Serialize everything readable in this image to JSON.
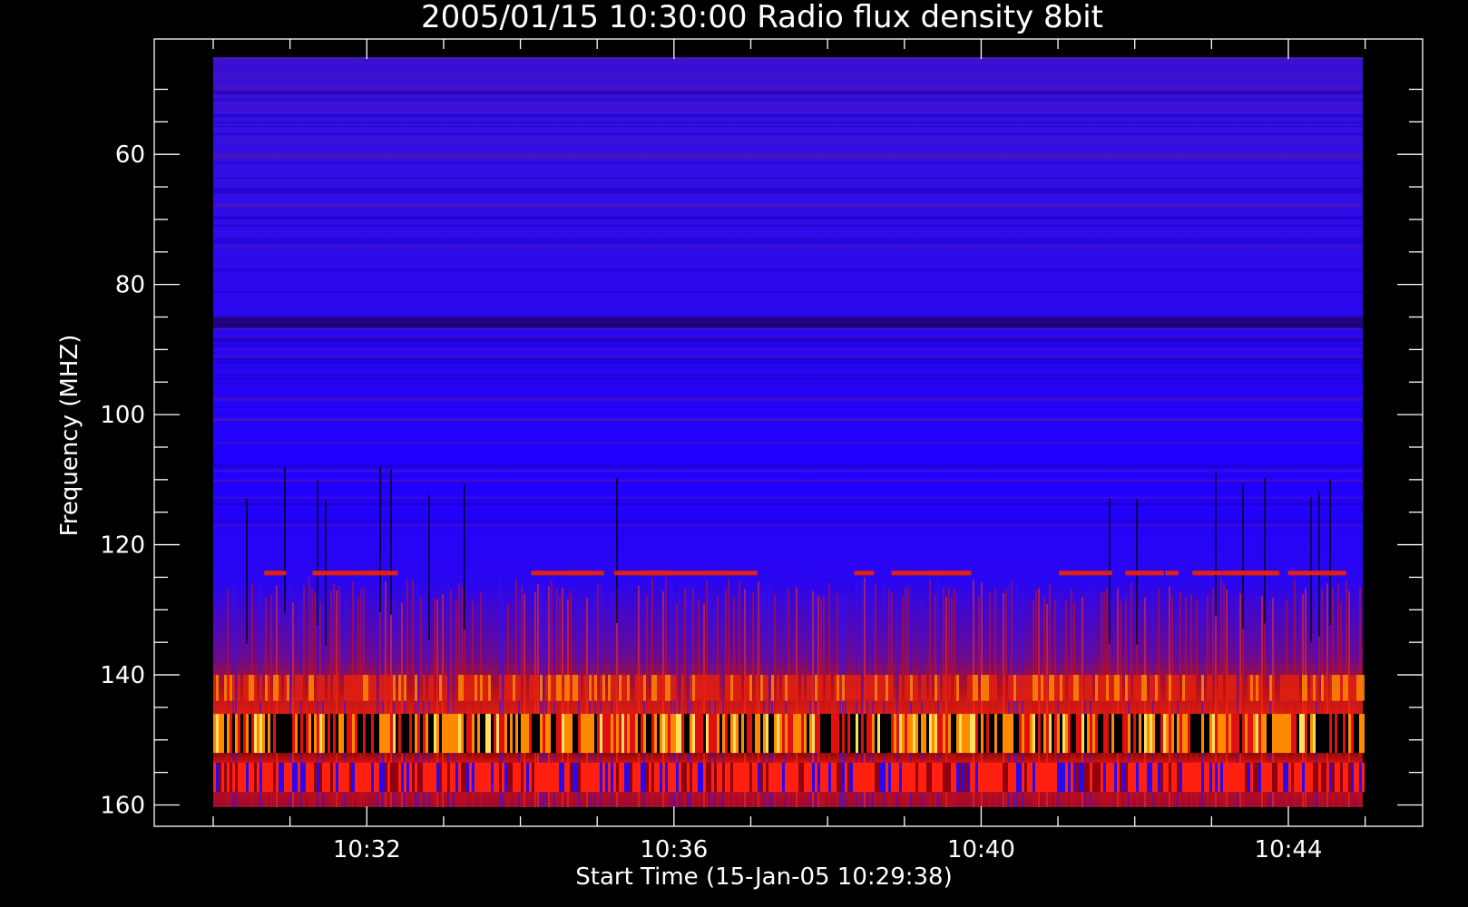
{
  "chart_data": {
    "type": "heatmap",
    "title": "2005/01/15 10:30:00 Radio flux density 8bit",
    "xlabel": "Start Time (15-Jan-05 10:29:38)",
    "ylabel": "Frequency (MHZ)",
    "x_ticks": [
      "10:32",
      "10:36",
      "10:40",
      "10:44"
    ],
    "y_ticks": [
      "60",
      "80",
      "100",
      "120",
      "140",
      "160"
    ],
    "x_range": [
      "10:29:38",
      "10:45:00"
    ],
    "ylim": [
      160,
      45
    ],
    "grid": false,
    "colors": {
      "background": "#000000",
      "low": "#1a00ff",
      "mid": "#cc1010",
      "high": "#ff8a00",
      "peak": "#ffe060"
    }
  }
}
